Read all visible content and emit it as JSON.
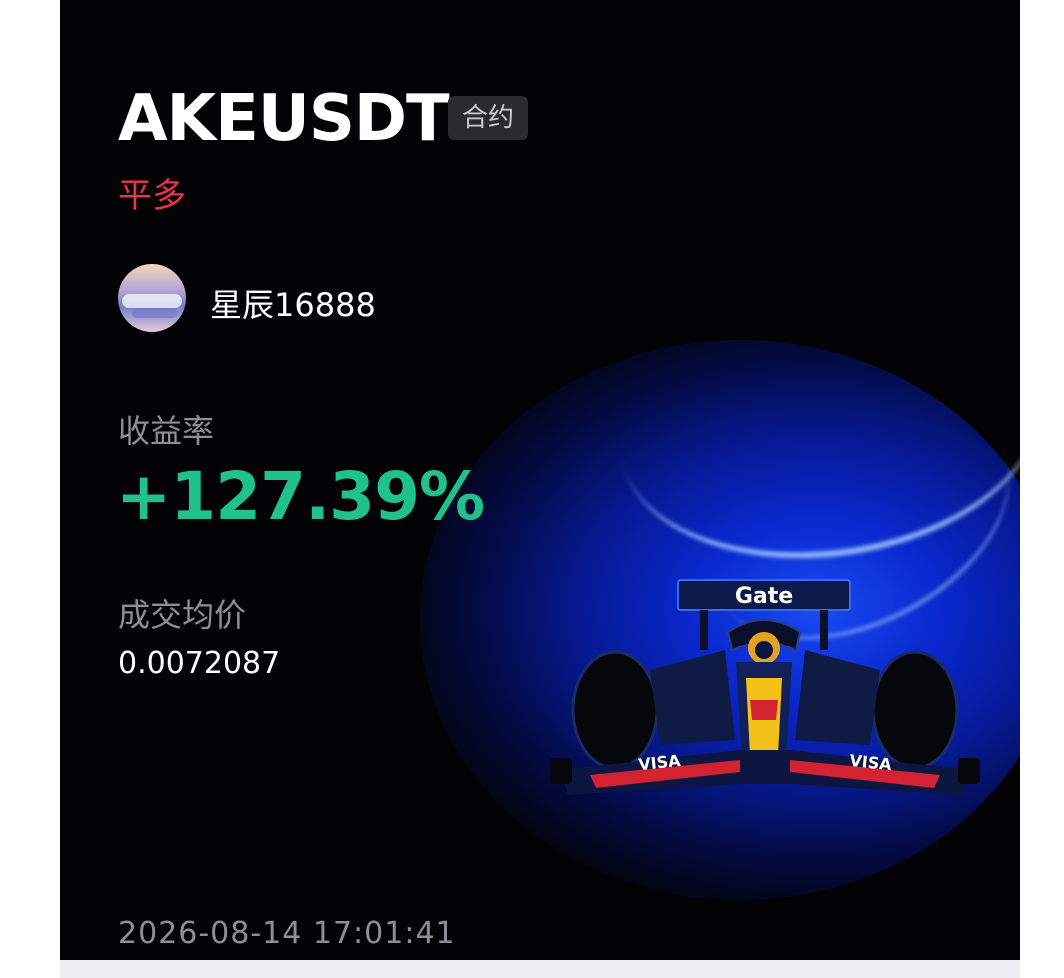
{
  "card": {
    "symbol": "AKEUSDT",
    "contract_tag": "合约",
    "action": "平多",
    "user": {
      "name": "星辰16888"
    },
    "roi_label": "收益率",
    "roi_value": "+127.39%",
    "avg_price_label": "成交均价",
    "avg_price_value": "0.0072087",
    "timestamp": "2026-08-14 17:01:41",
    "car_wing_text": "Gate",
    "car_sponsor_text": "VISA"
  },
  "colors": {
    "background": "#030305",
    "action_red": "#e8334d",
    "roi_green": "#1fc28b",
    "glow_blue": "#1a4fff",
    "muted_text": "#8d8f95"
  },
  "icons": {
    "avatar": "landscape-avatar",
    "car": "f1-race-car-illustration"
  }
}
